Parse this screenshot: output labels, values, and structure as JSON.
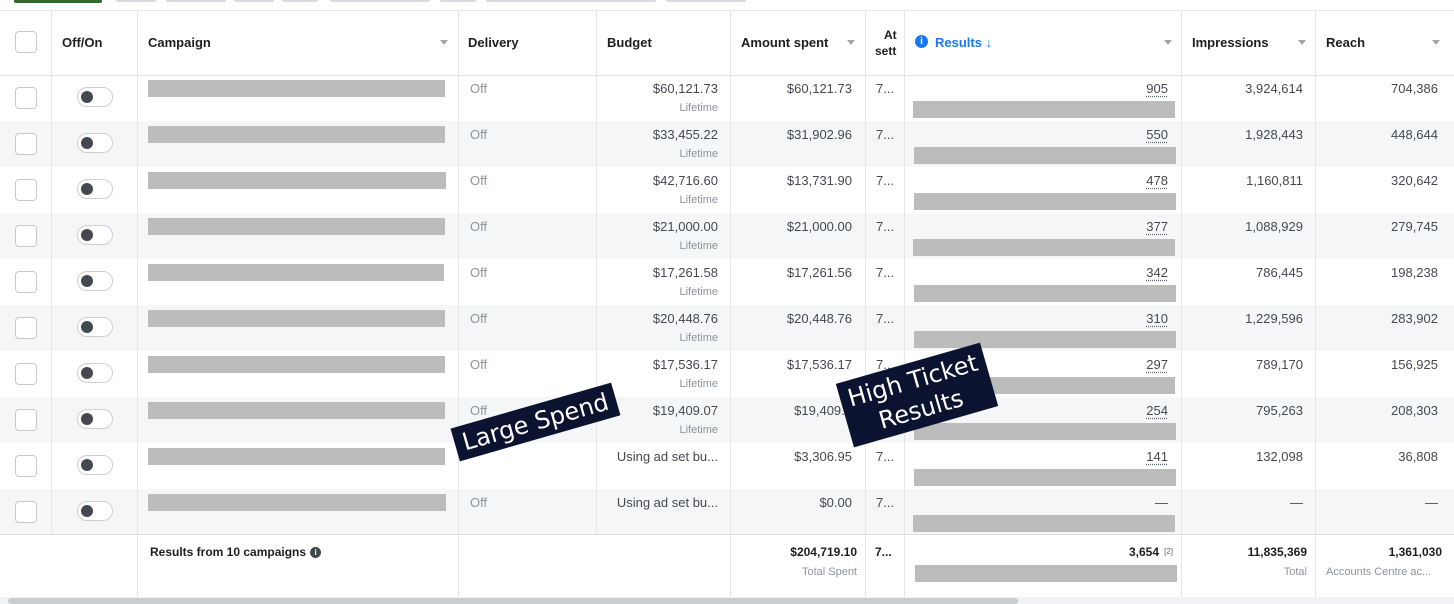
{
  "header": {
    "off_on": "Off/On",
    "campaign": "Campaign",
    "delivery": "Delivery",
    "budget": "Budget",
    "amount_spent": "Amount spent",
    "attribution_line1": "At",
    "attribution_line2": "sett",
    "results": "Results ↓",
    "impressions": "Impressions",
    "reach": "Reach"
  },
  "rows": [
    {
      "delivery": "Off",
      "budget": "$60,121.73",
      "budget_sub": "Lifetime",
      "spent": "$60,121.73",
      "attr": "7...",
      "results": "905",
      "impressions": "3,924,614",
      "reach": "704,386"
    },
    {
      "delivery": "Off",
      "budget": "$33,455.22",
      "budget_sub": "Lifetime",
      "spent": "$31,902.96",
      "attr": "7...",
      "results": "550",
      "impressions": "1,928,443",
      "reach": "448,644"
    },
    {
      "delivery": "Off",
      "budget": "$42,716.60",
      "budget_sub": "Lifetime",
      "spent": "$13,731.90",
      "attr": "7...",
      "results": "478",
      "impressions": "1,160,811",
      "reach": "320,642"
    },
    {
      "delivery": "Off",
      "budget": "$21,000.00",
      "budget_sub": "Lifetime",
      "spent": "$21,000.00",
      "attr": "7...",
      "results": "377",
      "impressions": "1,088,929",
      "reach": "279,745"
    },
    {
      "delivery": "Off",
      "budget": "$17,261.58",
      "budget_sub": "Lifetime",
      "spent": "$17,261.56",
      "attr": "7...",
      "results": "342",
      "impressions": "786,445",
      "reach": "198,238"
    },
    {
      "delivery": "Off",
      "budget": "$20,448.76",
      "budget_sub": "Lifetime",
      "spent": "$20,448.76",
      "attr": "7...",
      "results": "310",
      "impressions": "1,229,596",
      "reach": "283,902"
    },
    {
      "delivery": "Off",
      "budget": "$17,536.17",
      "budget_sub": "Lifetime",
      "spent": "$17,536.17",
      "attr": "7...",
      "results": "297",
      "impressions": "789,170",
      "reach": "156,925"
    },
    {
      "delivery": "Off",
      "budget": "$19,409.07",
      "budget_sub": "Lifetime",
      "spent": "$19,409.0",
      "attr": "",
      "results": "254",
      "impressions": "795,263",
      "reach": "208,303"
    },
    {
      "delivery": "",
      "budget": "Using ad set bu...",
      "budget_sub": "",
      "spent": "$3,306.95",
      "attr": "7...",
      "results": "141",
      "impressions": "132,098",
      "reach": "36,808"
    },
    {
      "delivery": "Off",
      "budget": "Using ad set bu...",
      "budget_sub": "",
      "spent": "$0.00",
      "attr": "7...",
      "results": "—",
      "impressions": "—",
      "reach": "—"
    }
  ],
  "footer": {
    "label": "Results from 10 campaigns",
    "spent": "$204,719.10",
    "spent_sub": "Total Spent",
    "attr": "7...",
    "results": "3,654",
    "results_ref": "[2]",
    "impressions": "11,835,369",
    "impressions_sub": "Total",
    "reach": "1,361,030",
    "reach_sub": "Accounts Centre ac..."
  },
  "annotations": {
    "large_spend": "Large Spend",
    "high_ticket_line1": "High Ticket",
    "high_ticket_line2": "Results"
  },
  "colors": {
    "accent": "#1877f2",
    "annotation_bg": "#0b1330",
    "redaction": "#bcbcbc"
  }
}
